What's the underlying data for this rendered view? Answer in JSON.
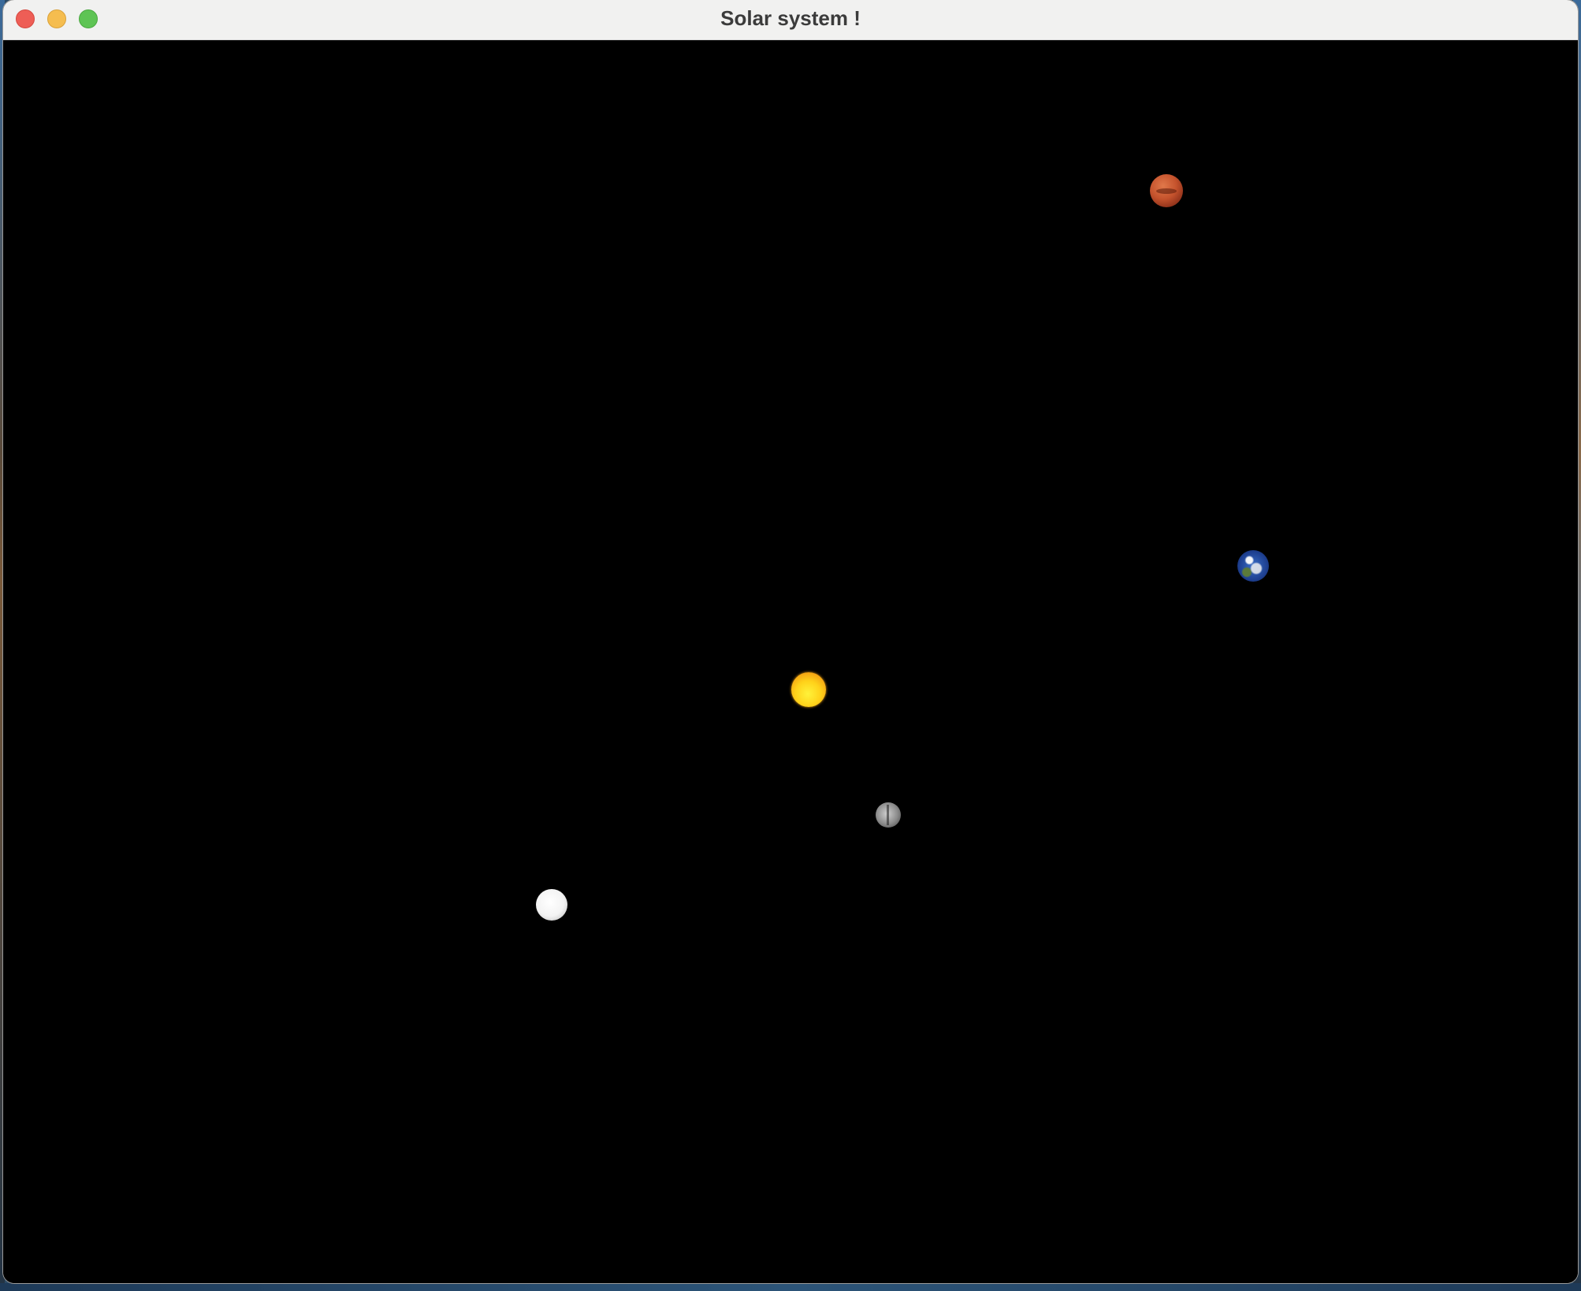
{
  "window": {
    "title": "Solar system !"
  },
  "scene": {
    "background_color": "#000000",
    "bodies": [
      {
        "name": "sun",
        "color": "#ffd21a"
      },
      {
        "name": "mars",
        "color": "#c5532d"
      },
      {
        "name": "earth",
        "color": "#1d3e8e"
      },
      {
        "name": "mercury",
        "color": "#8a8a8a"
      },
      {
        "name": "moon",
        "color": "#f3f3f3"
      }
    ]
  }
}
